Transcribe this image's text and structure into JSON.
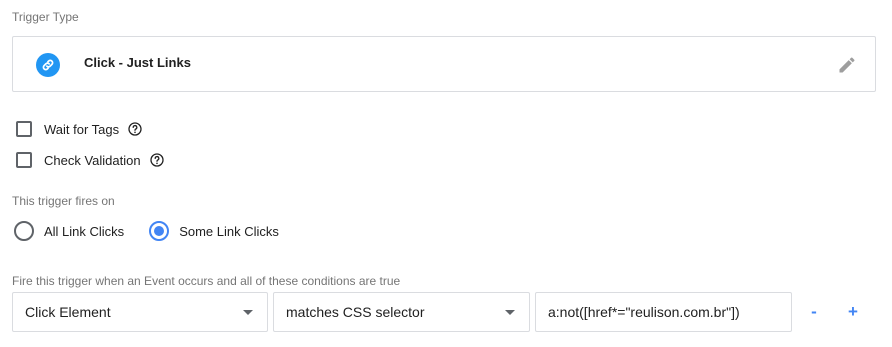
{
  "trigger_type": {
    "label": "Trigger Type",
    "name": "Click - Just Links",
    "icon": "link-icon",
    "icon_color": "#2196f3"
  },
  "options": {
    "wait_for_tags": {
      "label": "Wait for Tags",
      "checked": false
    },
    "check_validation": {
      "label": "Check Validation",
      "checked": false
    }
  },
  "fires_on": {
    "label": "This trigger fires on",
    "options": [
      {
        "label": "All Link Clicks",
        "selected": false
      },
      {
        "label": "Some Link Clicks",
        "selected": true
      }
    ]
  },
  "condition": {
    "label": "Fire this trigger when an Event occurs and all of these conditions are true",
    "variable": "Click Element",
    "operator": "matches CSS selector",
    "value": "a:not([href*=\"reulison.com.br\"])",
    "remove_label": "-",
    "add_label": "+"
  },
  "colors": {
    "accent": "#4285f4",
    "border": "#dadce0"
  }
}
